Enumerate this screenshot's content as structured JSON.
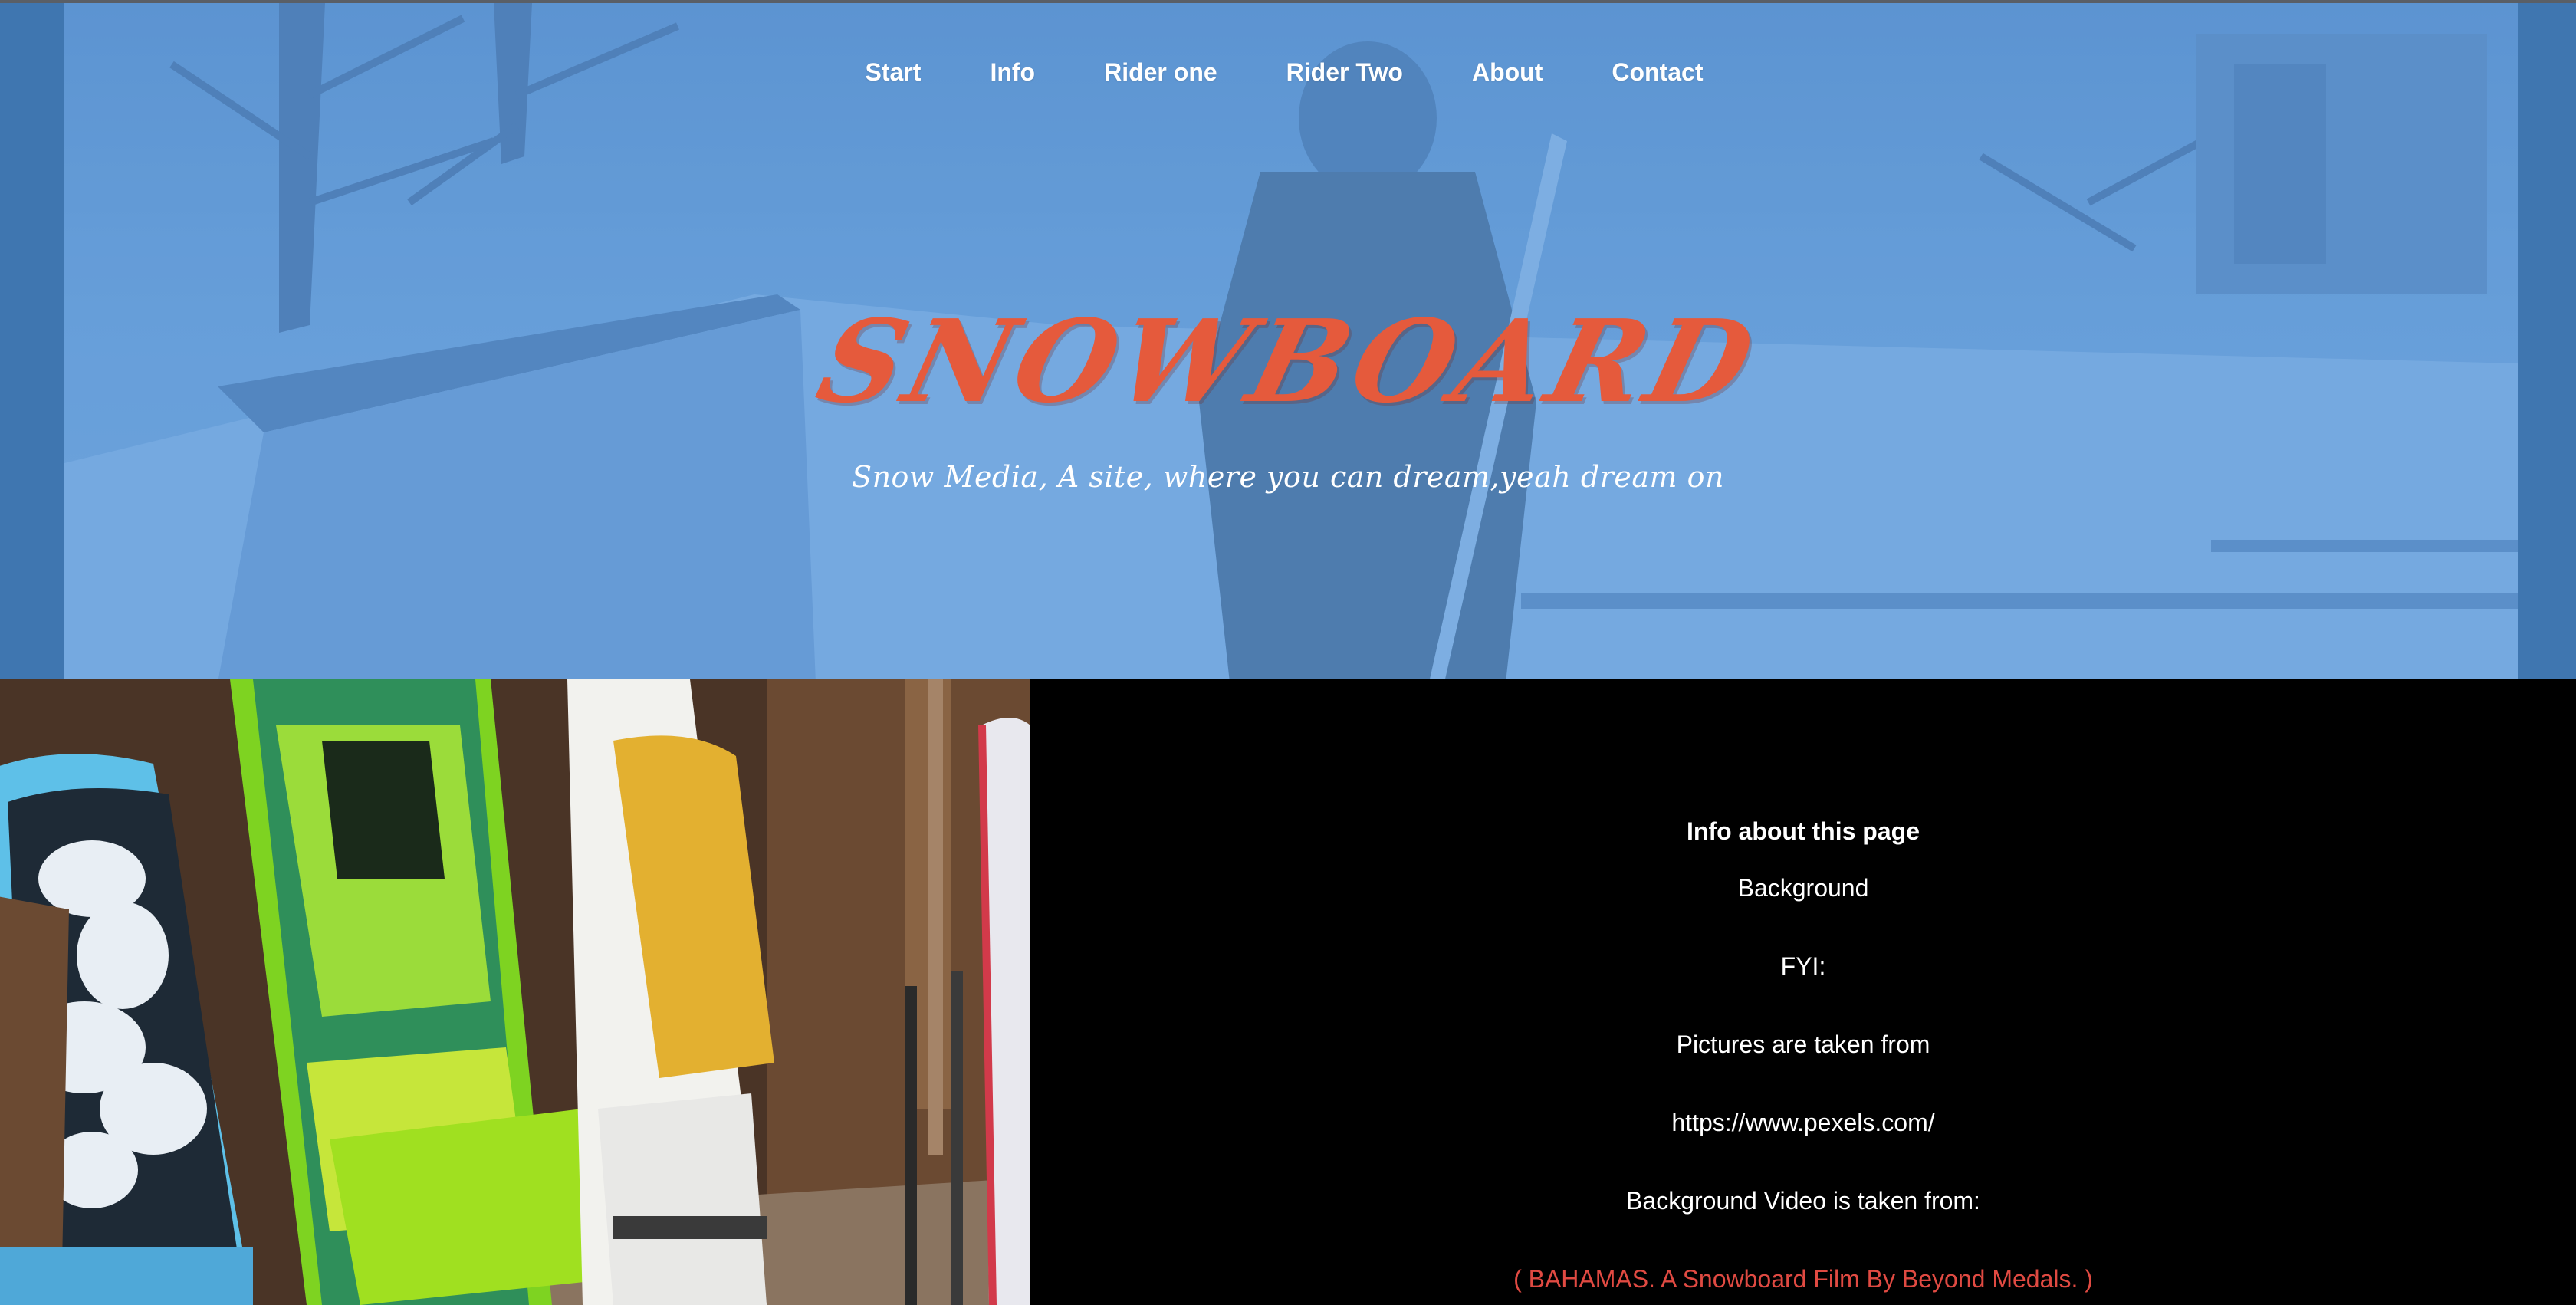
{
  "nav": {
    "items": [
      "Start",
      "Info",
      "Rider one",
      "Rider Two",
      "About",
      "Contact"
    ]
  },
  "hero": {
    "title": "SNOWBOARD",
    "subtitle": "Snow Media, A site, where you can dream,yeah dream on"
  },
  "info": {
    "heading": "Info about this page",
    "lines": [
      "Background",
      "FYI:",
      "Pictures are taken from",
      "https://www.pexels.com/",
      "Background Video is taken from:"
    ],
    "video_link": "( BAHAMAS. A Snowboard Film By Beyond Medals. )"
  },
  "colors": {
    "hero_blue": "#3f76b0",
    "title_red": "#e55a3c",
    "link_red": "#e04a42",
    "info_bg": "#000000"
  }
}
